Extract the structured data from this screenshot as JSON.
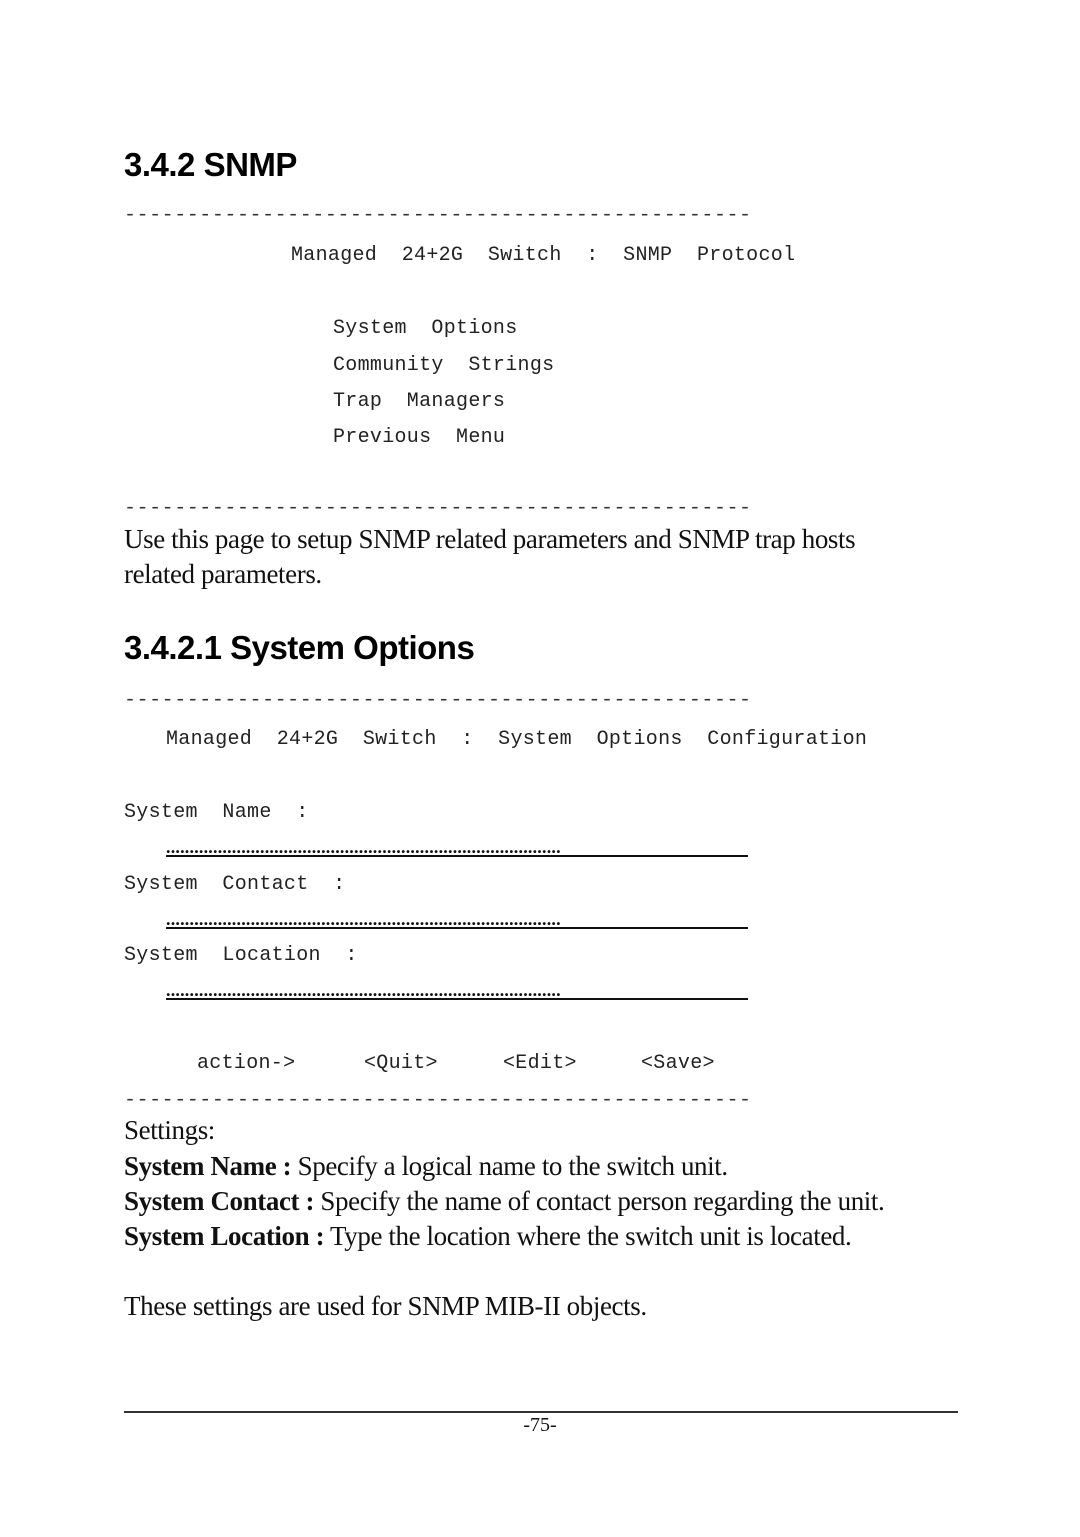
{
  "section": {
    "heading": "3.4.2 SNMP",
    "divider": "--------------------------------------------------",
    "terminal_title": "Managed  24+2G  Switch  :  SNMP  Protocol",
    "menu_items": [
      {
        "label": "System  Options"
      },
      {
        "label": "Community  Strings"
      },
      {
        "label": "Trap  Managers"
      },
      {
        "label": "Previous  Menu"
      }
    ],
    "description": "Use this page to setup SNMP related parameters and SNMP trap hosts",
    "description_line2": "related parameters."
  },
  "subsection": {
    "heading": "3.4.2.1 System Options",
    "terminal_title": "Managed  24+2G  Switch  :  System  Options  Configuration",
    "fields": [
      {
        "label": "System  Name  :",
        "value": "...................................................................................."
      },
      {
        "label": "System  Contact  :",
        "value": "...................................................................................."
      },
      {
        "label": "System  Location  :",
        "value": "...................................................................................."
      }
    ],
    "actions": {
      "prompt": "action->",
      "quit": "<Quit>",
      "edit": "<Edit>",
      "save": "<Save>"
    }
  },
  "settings": {
    "title": "Settings:",
    "items": [
      {
        "term": "System Name :",
        "desc": " Specify a logical name to the switch unit."
      },
      {
        "term": "System Contact :",
        "desc": " Specify the name of contact person regarding the unit."
      },
      {
        "term": "System Location :",
        "desc": " Type the location where the switch unit is located."
      }
    ],
    "note": "These settings are used for SNMP MIB-II objects."
  },
  "footer": {
    "page_number": "-75-"
  }
}
